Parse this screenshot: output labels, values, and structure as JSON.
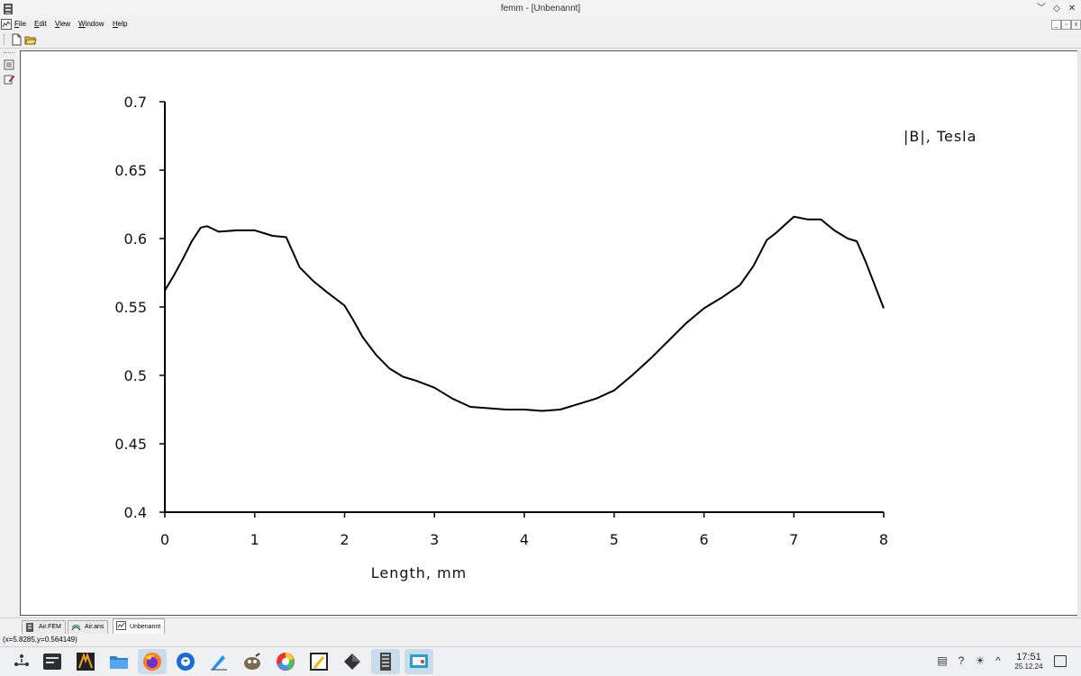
{
  "window": {
    "title": "femm - [Unbenannt]",
    "controls": [
      "﹀",
      "◇",
      "✕"
    ]
  },
  "menu": [
    "File",
    "Edit",
    "View",
    "Window",
    "Help"
  ],
  "tabs": [
    {
      "label": "Air.FEM",
      "icon": "femm-doc-icon"
    },
    {
      "label": "Air.ans",
      "icon": "solution-icon"
    },
    {
      "label": "Unbenannt",
      "icon": "plot-icon"
    }
  ],
  "status": {
    "coords": "(x=5.8285,y=0.564149)"
  },
  "taskbar": {
    "time": "17:51",
    "date": "25.12.24"
  },
  "chart_data": {
    "type": "line",
    "title": "",
    "xlabel": "Length, mm",
    "ylabel": "",
    "legend_label": "|B|, Tesla",
    "xlim": [
      0,
      8
    ],
    "ylim": [
      0.4,
      0.7
    ],
    "xticks": [
      "0",
      "1",
      "2",
      "3",
      "4",
      "5",
      "6",
      "7",
      "8"
    ],
    "yticks": [
      "0.4",
      "0.45",
      "0.5",
      "0.55",
      "0.6",
      "0.65",
      "0.7"
    ],
    "grid": false,
    "series": [
      {
        "x": [
          0,
          0.1,
          0.2,
          0.3,
          0.4,
          0.47,
          0.6,
          0.8,
          1.0,
          1.2,
          1.35,
          1.5,
          1.65,
          1.8,
          2.0,
          2.1,
          2.2,
          2.35,
          2.5,
          2.65,
          2.8,
          3.0,
          3.2,
          3.4,
          3.6,
          3.8,
          4.0,
          4.2,
          4.4,
          4.6,
          4.8,
          5.0,
          5.2,
          5.4,
          5.6,
          5.8,
          6.0,
          6.2,
          6.4,
          6.55,
          6.7,
          6.8,
          6.9,
          7.0,
          7.15,
          7.3,
          7.45,
          7.6,
          7.7,
          7.8,
          7.9,
          8.0
        ],
        "y": [
          0.562,
          0.573,
          0.585,
          0.598,
          0.608,
          0.609,
          0.605,
          0.606,
          0.606,
          0.602,
          0.601,
          0.579,
          0.569,
          0.561,
          0.551,
          0.54,
          0.528,
          0.515,
          0.505,
          0.499,
          0.496,
          0.491,
          0.483,
          0.477,
          0.476,
          0.475,
          0.475,
          0.474,
          0.475,
          0.479,
          0.483,
          0.489,
          0.5,
          0.512,
          0.525,
          0.538,
          0.549,
          0.557,
          0.566,
          0.58,
          0.599,
          0.604,
          0.61,
          0.616,
          0.614,
          0.614,
          0.606,
          0.6,
          0.598,
          0.583,
          0.566,
          0.549
        ]
      }
    ]
  }
}
